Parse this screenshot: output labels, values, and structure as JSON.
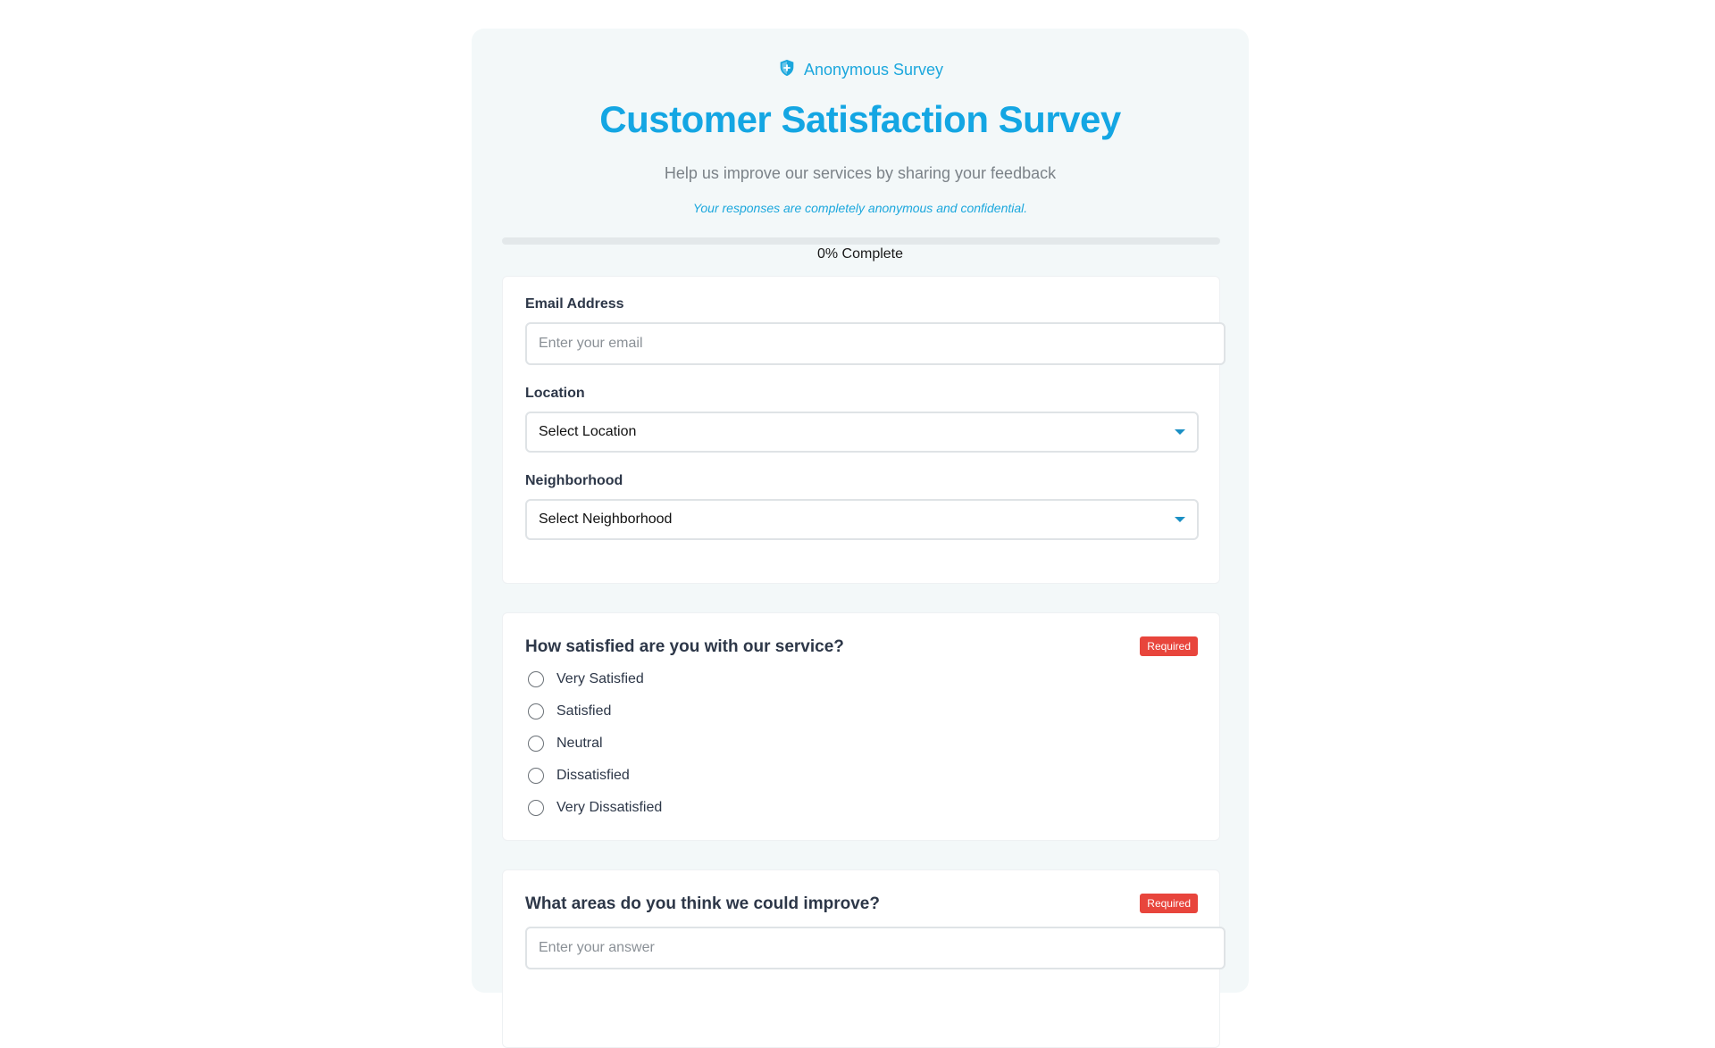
{
  "header": {
    "badge_label": "Anonymous Survey",
    "badge_icon": "shield-icon",
    "title": "Customer Satisfaction Survey",
    "subtitle": "Help us improve our services by sharing your feedback",
    "note": "Your responses are completely anonymous and confidential."
  },
  "progress": {
    "percent": 0,
    "label": "0% Complete"
  },
  "contact": {
    "email_label": "Email Address",
    "email_placeholder": "Enter your email",
    "email_value": "",
    "location_label": "Location",
    "location_value": "Select Location",
    "neighborhood_label": "Neighborhood",
    "neighborhood_value": "Select Neighborhood"
  },
  "q1": {
    "question": "How satisfied are you with our service?",
    "required_label": "Required",
    "options": [
      "Very Satisfied",
      "Satisfied",
      "Neutral",
      "Dissatisfied",
      "Very Dissatisfied"
    ]
  },
  "q2": {
    "question": "What areas do you think we could improve?",
    "required_label": "Required",
    "answer_placeholder": "Enter your answer",
    "answer_value": ""
  },
  "colors": {
    "accent": "#14a6e3",
    "required": "#e8453c",
    "panel_bg": "#f3f8f9"
  }
}
